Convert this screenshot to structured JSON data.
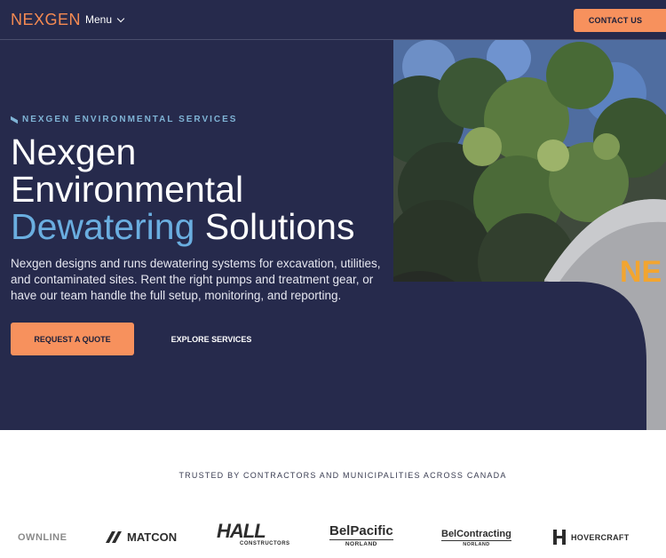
{
  "header": {
    "logo": "NEXGEN",
    "menu_label": "Menu",
    "contact_label": "CONTACT US"
  },
  "hero": {
    "eyebrow": "NEXGEN ENVIRONMENTAL SERVICES",
    "headline_line1": "Nexgen",
    "headline_line2": "Environmental",
    "headline_accent": "Dewatering",
    "headline_end": "Solutions",
    "description": "Nexgen designs and runs dewatering systems for excavation, utilities, and contaminated sites. Rent the right pumps and treatment gear, or have our team handle the full setup, monitoring, and reporting.",
    "primary_cta": "REQUEST A QUOTE",
    "secondary_cta": "EXPLORE SERVICES",
    "photo_tank_text": "NE"
  },
  "trusted": {
    "title": "TRUSTED BY CONTRACTORS AND MUNICIPALITIES ACROSS CANADA",
    "logos": {
      "ownline": "OWNLINE",
      "matcon": "MATCON",
      "hall": "HALL",
      "hall_sub": "CONSTRUCTORS",
      "belpacific": "BelPacific",
      "belpacific_sub": "NORLAND",
      "belcontracting": "BelContracting",
      "belcontracting_sub": "NORLAND",
      "hovercraft": "HOVERCRAFT"
    }
  },
  "colors": {
    "hero_bg": "#262a4c",
    "accent_orange": "#f7915d",
    "accent_blue": "#6aaee0"
  }
}
